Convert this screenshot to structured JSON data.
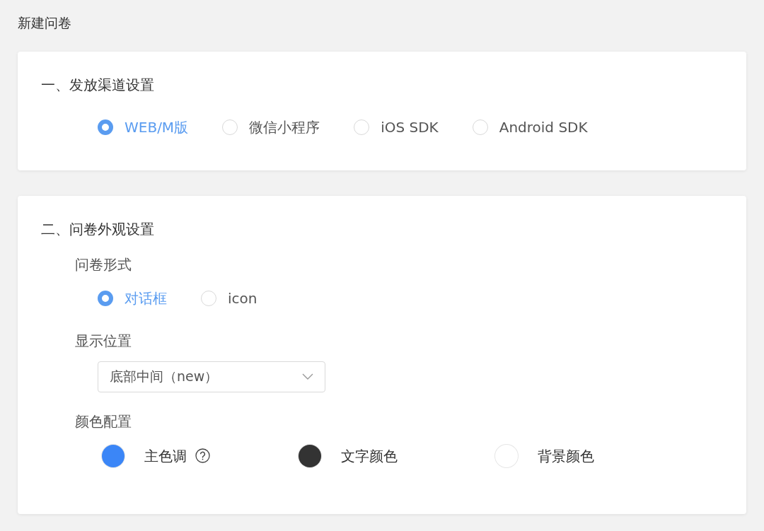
{
  "page_title": "新建问卷",
  "channel_section": {
    "title": "一、发放渠道设置",
    "options": [
      {
        "label": "WEB/M版",
        "selected": true
      },
      {
        "label": "微信小程序",
        "selected": false
      },
      {
        "label": "iOS SDK",
        "selected": false
      },
      {
        "label": "Android SDK",
        "selected": false
      }
    ]
  },
  "appearance_section": {
    "title": "二、问卷外观设置",
    "form_label": "问卷形式",
    "form_options": [
      {
        "label": "对话框",
        "selected": true
      },
      {
        "label": "icon",
        "selected": false
      }
    ],
    "position_label": "显示位置",
    "position_value": "底部中间（new）",
    "color_label": "颜色配置",
    "colors": [
      {
        "label": "主色调",
        "color": "#3b86f7",
        "help": true
      },
      {
        "label": "文字颜色",
        "color": "#333333",
        "help": false
      },
      {
        "label": "背景颜色",
        "color": "#ffffff",
        "help": false
      }
    ]
  }
}
